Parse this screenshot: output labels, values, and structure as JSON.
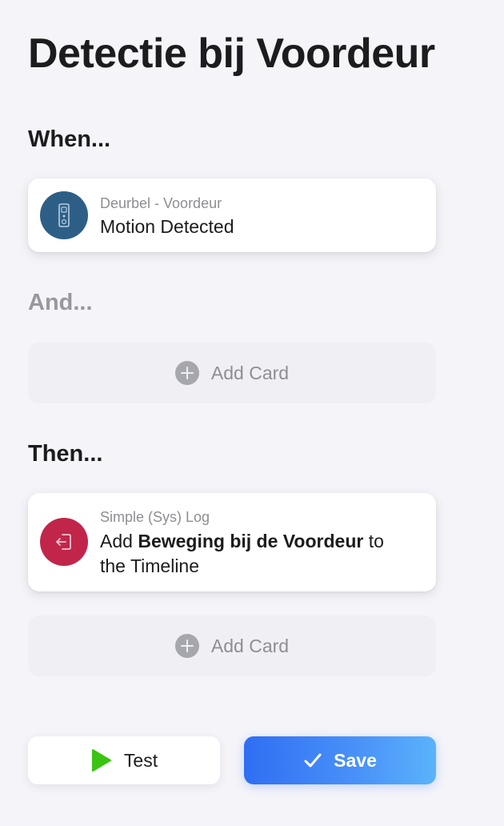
{
  "page": {
    "title": "Detectie bij Voordeur"
  },
  "sections": {
    "when_label": "When...",
    "and_label": "And...",
    "then_label": "Then..."
  },
  "when_card": {
    "subtitle": "Deurbel - Voordeur",
    "text": "Motion Detected",
    "icon": "doorbell-icon",
    "icon_color": "#2d5f86"
  },
  "and_section": {
    "add_card_label": "Add Card"
  },
  "then_card": {
    "subtitle": "Simple (Sys) Log",
    "text_prefix": "Add ",
    "text_bold": "Beweging bij de Voordeur",
    "text_suffix": " to the Timeline",
    "icon": "log-in-icon",
    "icon_color": "#c1264a"
  },
  "then_section": {
    "add_card_label": "Add Card"
  },
  "buttons": {
    "test_label": "Test",
    "save_label": "Save"
  },
  "colors": {
    "background": "#f4f4f9",
    "accent": "#2f6ef3",
    "play_green": "#3ac411"
  }
}
